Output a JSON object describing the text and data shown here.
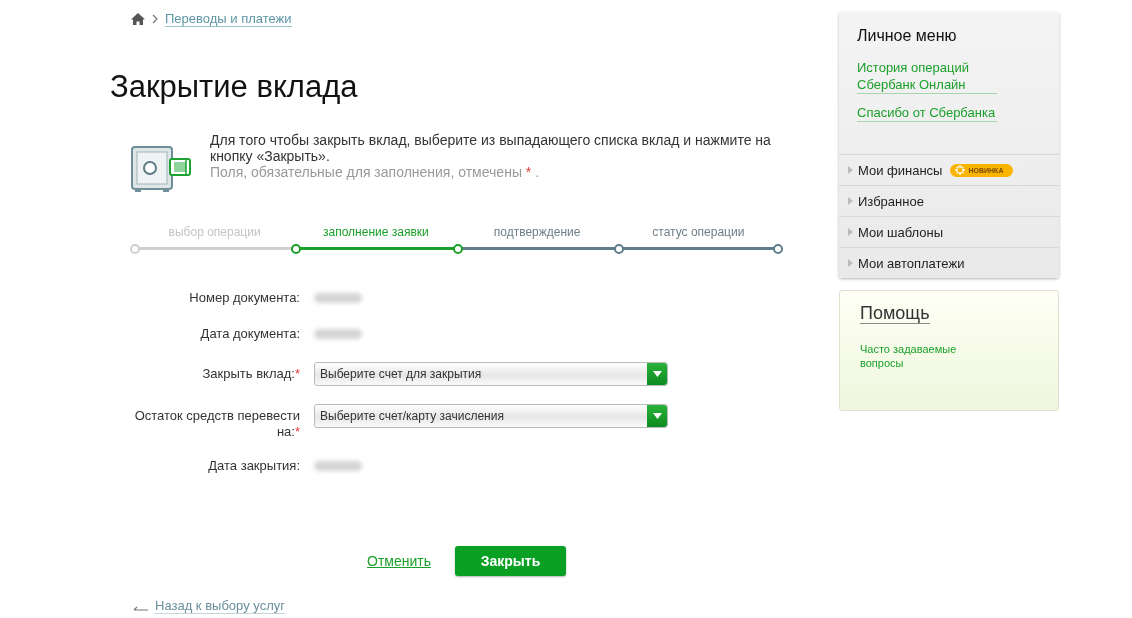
{
  "breadcrumb": {
    "link": "Переводы и платежи"
  },
  "title": "Закрытие вклада",
  "intro": {
    "text": "Для того чтобы закрыть вклад, выберите из выпадающего списка вклад и нажмите на кнопку «Закрыть».",
    "note": "Поля, обязательные для заполнения, отмечены",
    "note_mark": "*",
    "note_end": "."
  },
  "steps": [
    {
      "label": "выбор операции",
      "completed": true,
      "selected": false
    },
    {
      "label": "заполнение заявки",
      "completed": false,
      "selected": true
    },
    {
      "label": "подтверждение",
      "completed": false,
      "selected": false
    },
    {
      "label": "статус операции",
      "completed": false,
      "selected": false
    }
  ],
  "form": [
    {
      "label": "Номер документа:",
      "kind": "value"
    },
    {
      "label": "Дата документа:",
      "kind": "value"
    },
    {
      "label": "Закрыть вклад:",
      "required_mark": "*",
      "kind": "select",
      "placeholder": "Выберите счет для закрытия"
    },
    {
      "label": "Остаток средств перевести на:",
      "required_mark": "*",
      "kind": "select",
      "placeholder": "Выберите счет/карту зачисления"
    },
    {
      "label": "Дата закрытия:",
      "kind": "value"
    }
  ],
  "actions": {
    "cancel": "Отменить",
    "submit": "Закрыть"
  },
  "back_link": "Назад к выбору услуг",
  "sidebar": {
    "title": "Личное меню",
    "links": [
      "История операций Сбербанк Онлайн",
      "Спасибо от Сбербанка"
    ],
    "menu": [
      {
        "label": "Мои финансы",
        "expanded": false,
        "badge": "НОВИНКА"
      },
      {
        "label": "Избранное",
        "expanded": false
      },
      {
        "label": "Мои шаблоны",
        "expanded": false
      },
      {
        "label": "Мои автоплатежи",
        "expanded": false
      }
    ]
  },
  "help": {
    "title": "Помощь",
    "links": [
      "Часто задаваемые вопросы"
    ]
  }
}
